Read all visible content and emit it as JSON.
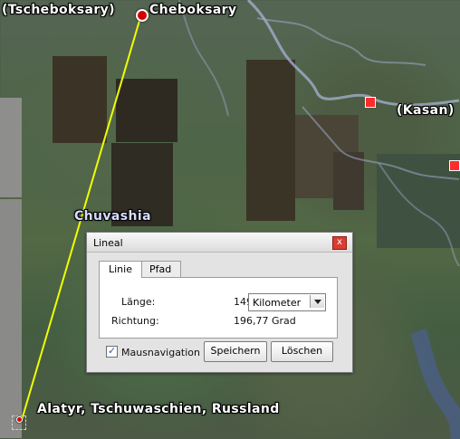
{
  "map": {
    "labels": {
      "tscheboksary": "(Tscheboksary)",
      "cheboksary": "Cheboksary",
      "kasan": "(Kasan)",
      "chuvashia": "Chuvashia",
      "alatyr": "Alatyr, Tschuwaschien, Russland"
    }
  },
  "dialog": {
    "title": "Lineal",
    "close_symbol": "x",
    "tabs": [
      {
        "label": "Linie"
      },
      {
        "label": "Pfad"
      }
    ],
    "line": {
      "length_label": "Länge:",
      "length_value": "149,86",
      "unit_selected": "Kilometer",
      "direction_label": "Richtung:",
      "direction_value": "196,77 Grad"
    },
    "mouse_navigation_label": "Mausnavigation",
    "mouse_navigation_checked": true,
    "save_button": "Speichern",
    "delete_button": "Löschen"
  }
}
